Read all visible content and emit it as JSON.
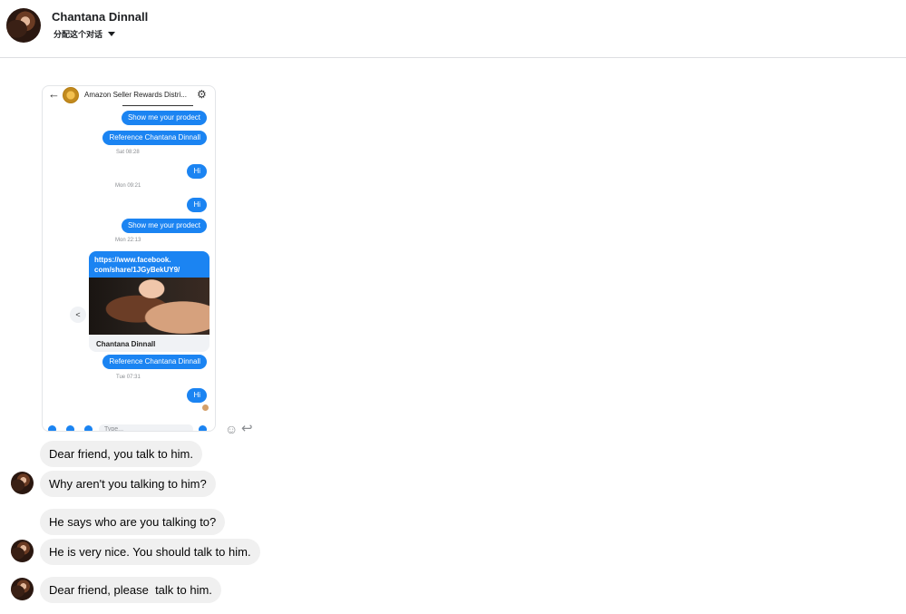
{
  "header": {
    "name": "Chantana Dinnall",
    "assign_label": "分配这个对话"
  },
  "screenshot": {
    "title": "Amazon Seller Rewards Distri...",
    "bubbles": [
      "Show me your prodect",
      "Reference Chantana Dinnall",
      "Hi",
      "Hi",
      "Show me your prodect",
      "Reference Chantana Dinnall",
      "Hi"
    ],
    "timestamps": [
      "Sat 08:28",
      "Mon 09:21",
      "Mon 22:13",
      "Tue 07:31"
    ],
    "link": {
      "url_line1": "https://www.facebook.",
      "url_line2": "com/share/1JGyBekUY9/",
      "name": "Chantana Dinnall"
    },
    "composer_placeholder": "Type..."
  },
  "messages": [
    "Dear friend, you talk to him.",
    "Why aren't you talking to him?",
    "He says who are you talking to?",
    "He is very nice. You should talk to him.",
    "Dear friend, please  talk to him."
  ],
  "icons": {
    "back": "←",
    "gear": "⚙",
    "share": "<",
    "emoji": "☺",
    "reply": "↩"
  }
}
